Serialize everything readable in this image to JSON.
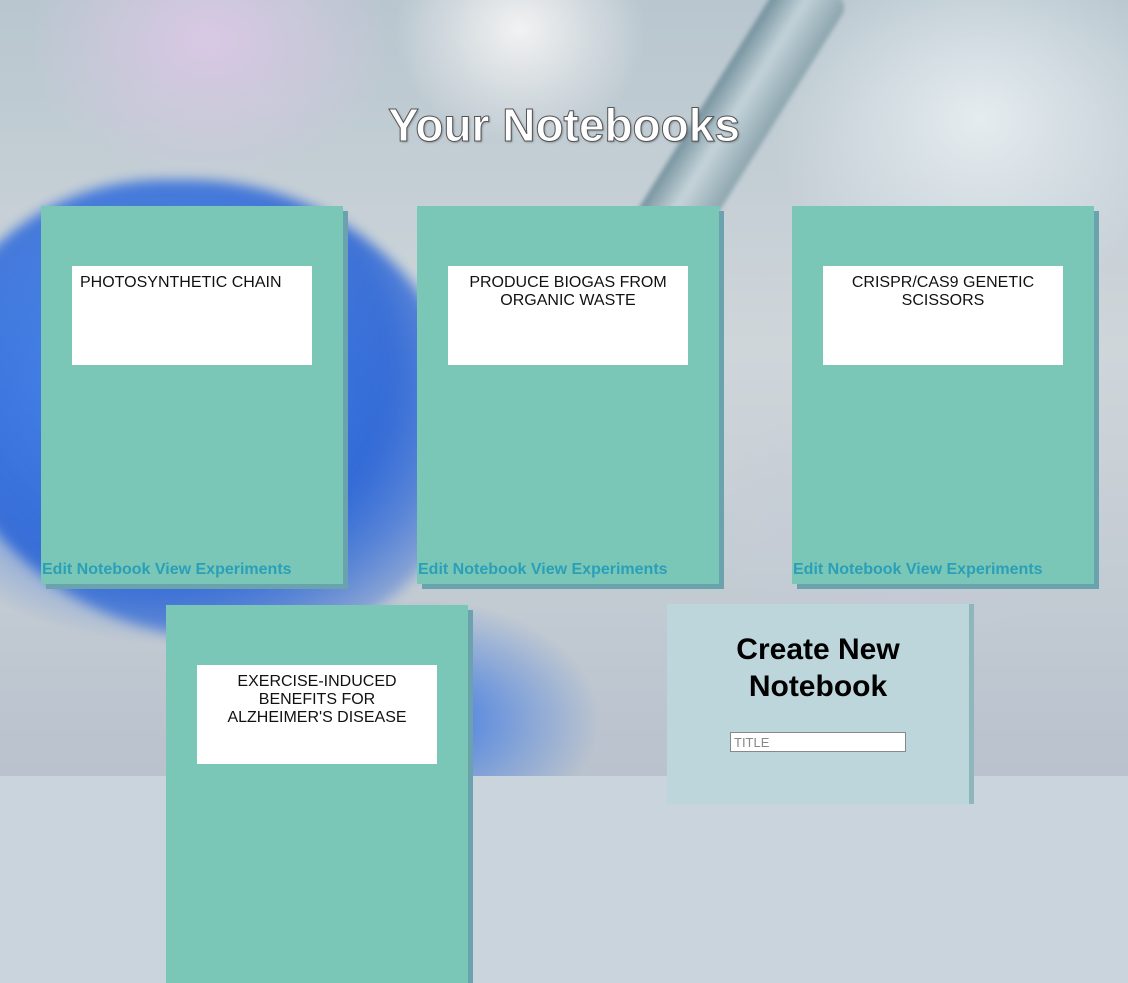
{
  "page": {
    "title": "Your Notebooks"
  },
  "actions": {
    "edit_label": "Edit Notebook",
    "view_label": "View Experiments"
  },
  "notebooks": [
    {
      "title": "PHOTOSYNTHETIC CHAIN"
    },
    {
      "title": "PRODUCE BIOGAS FROM ORGANIC WASTE"
    },
    {
      "title": "CRISPR/CAS9 GENETIC SCISSORS"
    },
    {
      "title": "EXERCISE-INDUCED BENEFITS FOR ALZHEIMER'S DISEASE"
    }
  ],
  "create": {
    "heading": "Create New Notebook",
    "title_placeholder": "TITLE"
  },
  "colors": {
    "notebook_bg": "#7ac7b7",
    "link": "#2b9fb7",
    "create_bg": "#bcd6dc"
  }
}
